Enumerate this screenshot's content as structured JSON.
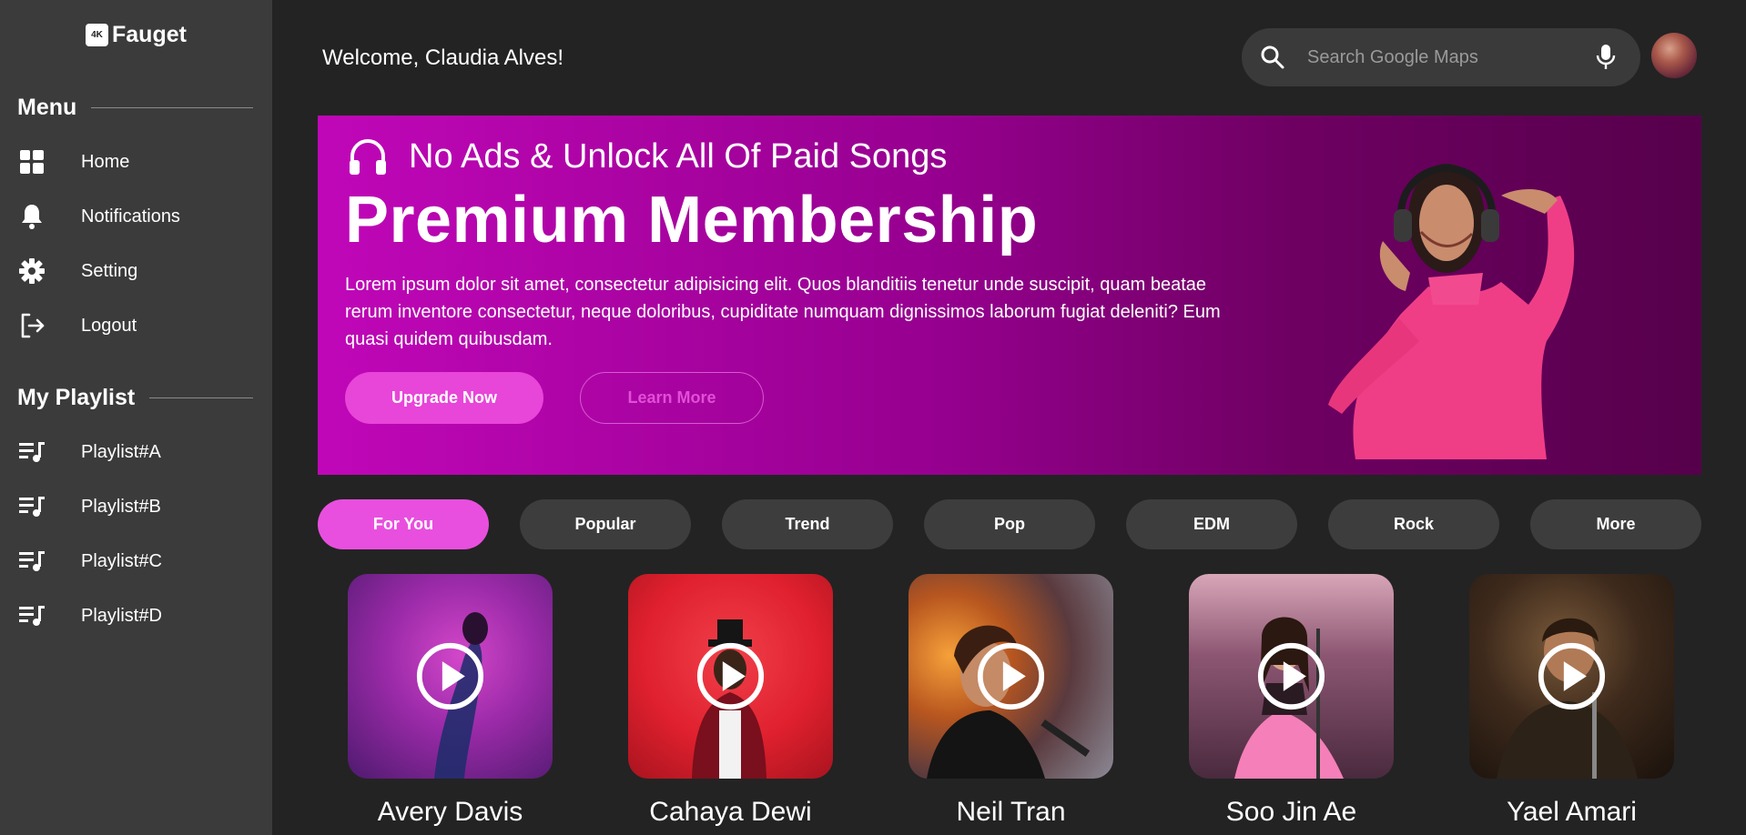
{
  "app": {
    "logo_badge": "4K",
    "logo_text": "Fauget"
  },
  "sidebar": {
    "menu_title": "Menu",
    "menu_items": [
      {
        "label": "Home",
        "icon": "dashboard-icon"
      },
      {
        "label": "Notifications",
        "icon": "bell-icon"
      },
      {
        "label": "Setting",
        "icon": "gear-icon"
      },
      {
        "label": "Logout",
        "icon": "logout-icon"
      }
    ],
    "playlist_title": "My Playlist",
    "playlists": [
      {
        "label": "Playlist#A",
        "icon": "playlist-icon"
      },
      {
        "label": "Playlist#B",
        "icon": "playlist-icon"
      },
      {
        "label": "Playlist#C",
        "icon": "playlist-icon"
      },
      {
        "label": "Playlist#D",
        "icon": "playlist-icon"
      }
    ]
  },
  "header": {
    "welcome": "Welcome, Claudia Alves!",
    "search_placeholder": "Search Google Maps"
  },
  "banner": {
    "subtitle": "No Ads & Unlock All Of Paid Songs",
    "title": "Premium Membership",
    "description": "Lorem ipsum dolor sit amet, consectetur adipisicing elit. Quos blanditiis tenetur unde suscipit, quam beatae rerum inventore consectetur, neque doloribus, cupiditate numquam dignissimos laborum fugiat deleniti? Eum quasi quidem quibusdam.",
    "upgrade_label": "Upgrade Now",
    "learn_label": "Learn More"
  },
  "tabs": [
    {
      "label": "For You",
      "active": true
    },
    {
      "label": "Popular",
      "active": false
    },
    {
      "label": "Trend",
      "active": false
    },
    {
      "label": "Pop",
      "active": false
    },
    {
      "label": "EDM",
      "active": false
    },
    {
      "label": "Rock",
      "active": false
    },
    {
      "label": "More",
      "active": false
    }
  ],
  "artists": [
    {
      "name": "Avery Davis"
    },
    {
      "name": "Cahaya Dewi"
    },
    {
      "name": "Neil Tran"
    },
    {
      "name": "Soo Jin Ae"
    },
    {
      "name": "Yael Amari"
    }
  ],
  "colors": {
    "accent": "#e84fde",
    "sidebar_bg": "#3b3b3b",
    "page_bg": "#232323"
  }
}
